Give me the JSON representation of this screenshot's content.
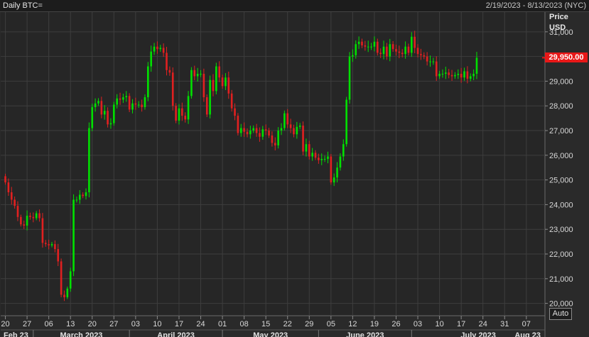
{
  "header": {
    "title": "Daily BTC=",
    "date_range": "2/19/2023 - 8/13/2023 (NYC)"
  },
  "controls": {
    "auto_label": "Auto"
  },
  "colors": {
    "up": "#00e000",
    "down": "#e02020",
    "grid": "#3e3e3e",
    "plot_bg": "#262626",
    "axis_text": "#d8d8d8",
    "last_price_bg": "#e81818"
  },
  "chart_data": {
    "type": "candlestick",
    "title": "Daily BTC=",
    "y_axis": {
      "title_line1": "Price",
      "title_line2": "USD",
      "ylim": [
        19500,
        31800
      ],
      "ticks": [
        20000,
        21000,
        22000,
        23000,
        24000,
        25000,
        26000,
        27000,
        28000,
        29000,
        30000,
        31000
      ],
      "tick_labels": [
        "20,000",
        "21,000",
        "22,000",
        "23,000",
        "24,000",
        "25,000",
        "26,000",
        "27,000",
        "28,000",
        "29,000",
        "30,000",
        "31,000"
      ],
      "position": "right"
    },
    "last_price": 29950,
    "last_price_label": "29,950.00",
    "x_axis": {
      "start_date": "2023-02-19",
      "end_date": "2023-08-13",
      "day_ticks": [
        {
          "date": "2023-02-20",
          "label": "20"
        },
        {
          "date": "2023-02-27",
          "label": "27"
        },
        {
          "date": "2023-03-06",
          "label": "06"
        },
        {
          "date": "2023-03-13",
          "label": "13"
        },
        {
          "date": "2023-03-20",
          "label": "20"
        },
        {
          "date": "2023-03-27",
          "label": "27"
        },
        {
          "date": "2023-04-03",
          "label": "03"
        },
        {
          "date": "2023-04-10",
          "label": "10"
        },
        {
          "date": "2023-04-17",
          "label": "17"
        },
        {
          "date": "2023-04-24",
          "label": "24"
        },
        {
          "date": "2023-05-01",
          "label": "01"
        },
        {
          "date": "2023-05-08",
          "label": "08"
        },
        {
          "date": "2023-05-15",
          "label": "15"
        },
        {
          "date": "2023-05-22",
          "label": "22"
        },
        {
          "date": "2023-05-29",
          "label": "29"
        },
        {
          "date": "2023-06-05",
          "label": "05"
        },
        {
          "date": "2023-06-12",
          "label": "12"
        },
        {
          "date": "2023-06-19",
          "label": "19"
        },
        {
          "date": "2023-06-26",
          "label": "26"
        },
        {
          "date": "2023-07-03",
          "label": "03"
        },
        {
          "date": "2023-07-10",
          "label": "10"
        },
        {
          "date": "2023-07-17",
          "label": "17"
        },
        {
          "date": "2023-07-24",
          "label": "24"
        },
        {
          "date": "2023-07-31",
          "label": "31"
        },
        {
          "date": "2023-08-07",
          "label": "07"
        }
      ],
      "month_labels": [
        {
          "date": "2023-02-19",
          "label": "Feb 23"
        },
        {
          "date": "2023-03-01",
          "label": "March 2023"
        },
        {
          "date": "2023-04-01",
          "label": "April 2023"
        },
        {
          "date": "2023-05-01",
          "label": "May 2023"
        },
        {
          "date": "2023-06-01",
          "label": "June 2023"
        },
        {
          "date": "2023-07-01",
          "label": "July 2023"
        },
        {
          "date": "2023-08-01",
          "label": "Aug 23"
        }
      ]
    },
    "grid": true,
    "closes": [
      24900,
      24500,
      24200,
      23950,
      23500,
      23200,
      23150,
      23550,
      23500,
      23450,
      23650,
      23450,
      22450,
      22400,
      22350,
      22400,
      22200,
      21700,
      20350,
      20250,
      20600,
      21300,
      24200,
      24200,
      24400,
      24350,
      24500,
      27100,
      27950,
      28100,
      28200,
      27650,
      27800,
      27250,
      27300,
      28050,
      28300,
      28250,
      28350,
      28400,
      27850,
      28100,
      28050,
      28050,
      27950,
      28350,
      29600,
      30200,
      30400,
      30300,
      30350,
      30150,
      29450,
      29350,
      28000,
      27400,
      27900,
      27600,
      27450,
      28400,
      29450,
      29200,
      29300,
      29300,
      28350,
      27650,
      29050,
      28600,
      29600,
      29150,
      28800,
      29150,
      28500,
      27900,
      27600,
      26900,
      27100,
      26950,
      26850,
      27000,
      27100,
      26900,
      26750,
      27050,
      27000,
      26800,
      26500,
      26400,
      27000,
      27100,
      27700,
      27250,
      27100,
      26850,
      27150,
      27200,
      26150,
      26450,
      25950,
      26100,
      25900,
      25800,
      25850,
      25850,
      25950,
      24900,
      25100,
      25500,
      25950,
      26450,
      28250,
      30000,
      30050,
      30500,
      30600,
      30450,
      30400,
      30400,
      30400,
      30600,
      30150,
      30100,
      30400,
      30000,
      30500,
      30300,
      30200,
      30150,
      30100,
      30400,
      30150,
      30800,
      30350,
      30100,
      30050,
      30000,
      29800,
      29800,
      29800,
      29200,
      29300,
      29300,
      29350,
      29250,
      29200,
      29250,
      29300,
      29150,
      29400,
      29100,
      29200,
      29300,
      29950
    ]
  }
}
